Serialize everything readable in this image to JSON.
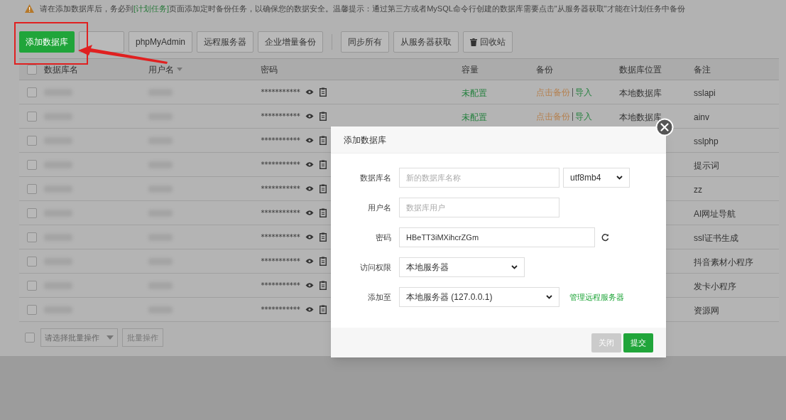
{
  "notice": {
    "before": "请在添加数据库后，务必到",
    "link": "[计划任务]",
    "after": "页面添加定时备份任务，以确保您的数据安全。温馨提示：通过第三方或者MySQL命令行创建的数据库需要点击\"从服务器获取\"才能在计划任务中备份"
  },
  "toolbar_groups": [
    [
      {
        "label": "添加数据库",
        "kind": "primary"
      },
      {
        "kind": "covered"
      },
      {
        "label": "phpMyAdmin",
        "kind": "default"
      },
      {
        "label": "远程服务器",
        "kind": "default"
      },
      {
        "label": "企业增量备份",
        "kind": "default"
      }
    ],
    [
      {
        "label": "同步所有",
        "kind": "default"
      },
      {
        "label": "从服务器获取",
        "kind": "default"
      },
      {
        "label": "回收站",
        "kind": "trash"
      }
    ]
  ],
  "table": {
    "columns": [
      {
        "label": "数据库名",
        "sortable": false
      },
      {
        "label": "用户名",
        "sortable": true
      },
      {
        "label": "密码",
        "sortable": false
      },
      {
        "label": "容量",
        "sortable": false
      },
      {
        "label": "备份",
        "sortable": false
      },
      {
        "label": "数据库位置",
        "sortable": false
      },
      {
        "label": "备注",
        "sortable": false
      }
    ],
    "header_checked": false,
    "rows": [
      {
        "checked": false,
        "password": "***********",
        "capacity": "未配置",
        "backup": "点击备份",
        "import": "导入",
        "location": "本地数据库",
        "note": "sslapi"
      },
      {
        "checked": false,
        "password": "***********",
        "capacity": "未配置",
        "backup": "点击备份",
        "import": "导入",
        "location": "本地数据库",
        "note": "ainv"
      },
      {
        "checked": false,
        "password": "***********",
        "note": "sslphp"
      },
      {
        "checked": false,
        "password": "***********",
        "note": "提示词"
      },
      {
        "checked": false,
        "password": "***********",
        "note": "zz"
      },
      {
        "checked": false,
        "password": "***********",
        "note": "AI网址导航"
      },
      {
        "checked": false,
        "password": "***********",
        "note": "ssl证书生成"
      },
      {
        "checked": false,
        "password": "***********",
        "note": "抖音素材小程序"
      },
      {
        "checked": false,
        "password": "***********",
        "note": "发卡小程序"
      },
      {
        "checked": false,
        "password": "***********",
        "note": "资源网"
      }
    ]
  },
  "bulk": {
    "checked": false,
    "select_placeholder": "请选择批量操作",
    "button": "批量操作"
  },
  "dialog": {
    "title": "添加数据库",
    "fields": [
      {
        "kind": "name",
        "label": "数据库名",
        "placeholder": "新的数据库名称",
        "charset": "utf8mb4"
      },
      {
        "kind": "user",
        "label": "用户名",
        "placeholder": "数据库用户"
      },
      {
        "kind": "password",
        "label": "密码",
        "value": "HBeTT3iMXihcrZGm"
      },
      {
        "kind": "access",
        "label": "访问权限",
        "value": "本地服务器"
      },
      {
        "kind": "target",
        "label": "添加至",
        "value": "本地服务器 (127.0.0.1)",
        "link": "管理远程服务器"
      }
    ],
    "buttons": [
      {
        "label": "关闭",
        "kind": "secondary"
      },
      {
        "label": "提交",
        "kind": "primary"
      }
    ]
  }
}
